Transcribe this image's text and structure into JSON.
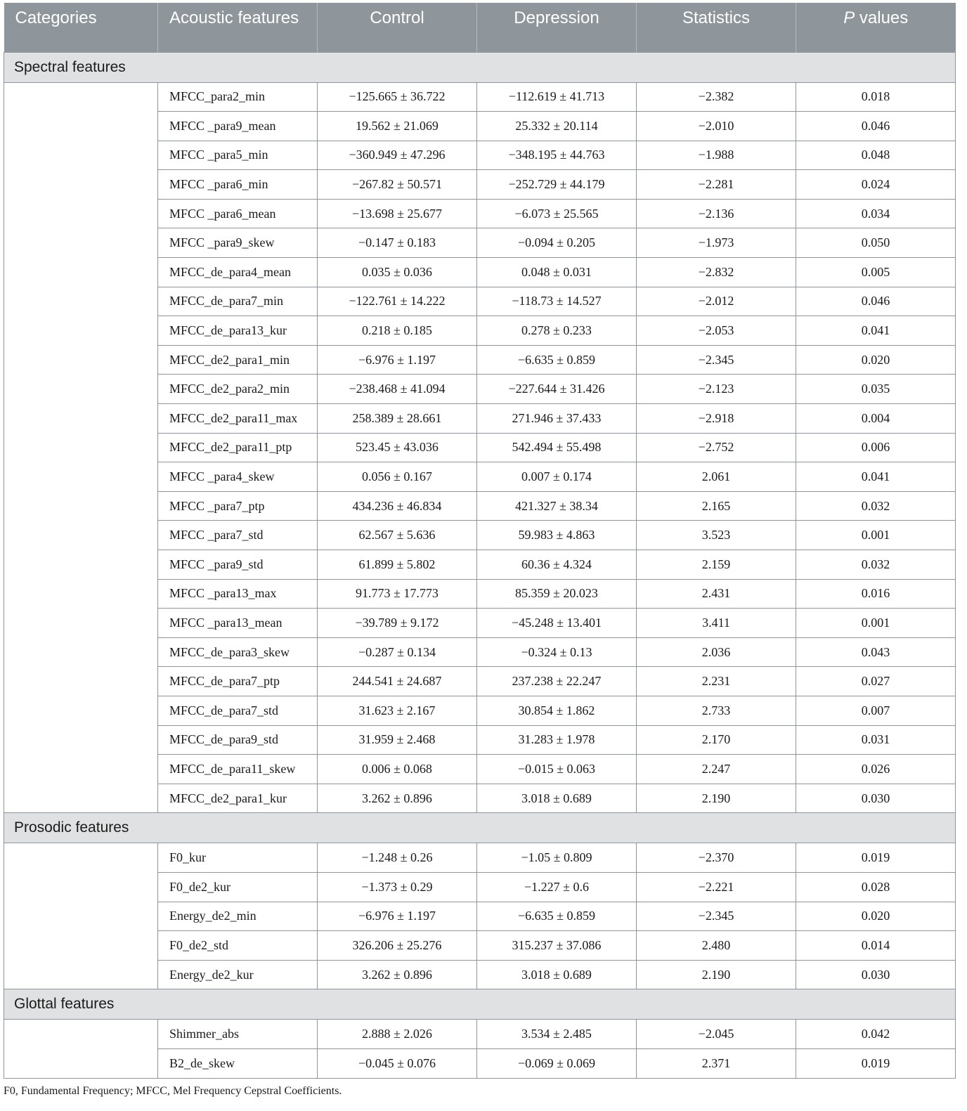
{
  "header": {
    "categories": "Categories",
    "acoustic_features": "Acoustic features",
    "control": "Control",
    "depression": "Depression",
    "statistics": "Statistics",
    "p_values_italic": "P",
    "p_values_rest": " values"
  },
  "sections": [
    {
      "name": "Spectral features",
      "rows": [
        {
          "feature": "MFCC_para2_min",
          "control": "−125.665 ± 36.722",
          "depression": "−112.619 ± 41.713",
          "statistics": "−2.382",
          "p": "0.018"
        },
        {
          "feature": "MFCC _para9_mean",
          "control": "19.562 ± 21.069",
          "depression": "25.332 ± 20.114",
          "statistics": "−2.010",
          "p": "0.046"
        },
        {
          "feature": "MFCC _para5_min",
          "control": "−360.949 ± 47.296",
          "depression": "−348.195 ± 44.763",
          "statistics": "−1.988",
          "p": "0.048"
        },
        {
          "feature": "MFCC _para6_min",
          "control": "−267.82 ± 50.571",
          "depression": "−252.729 ± 44.179",
          "statistics": "−2.281",
          "p": "0.024"
        },
        {
          "feature": "MFCC _para6_mean",
          "control": "−13.698 ± 25.677",
          "depression": "−6.073 ± 25.565",
          "statistics": "−2.136",
          "p": "0.034"
        },
        {
          "feature": "MFCC _para9_skew",
          "control": "−0.147 ± 0.183",
          "depression": "−0.094 ± 0.205",
          "statistics": "−1.973",
          "p": "0.050"
        },
        {
          "feature": "MFCC_de_para4_mean",
          "control": "0.035 ± 0.036",
          "depression": "0.048 ± 0.031",
          "statistics": "−2.832",
          "p": "0.005"
        },
        {
          "feature": "MFCC_de_para7_min",
          "control": "−122.761 ± 14.222",
          "depression": "−118.73 ± 14.527",
          "statistics": "−2.012",
          "p": "0.046"
        },
        {
          "feature": "MFCC_de_para13_kur",
          "control": "0.218 ± 0.185",
          "depression": "0.278 ± 0.233",
          "statistics": "−2.053",
          "p": "0.041"
        },
        {
          "feature": "MFCC_de2_para1_min",
          "control": "−6.976 ± 1.197",
          "depression": "−6.635 ± 0.859",
          "statistics": "−2.345",
          "p": "0.020"
        },
        {
          "feature": "MFCC_de2_para2_min",
          "control": "−238.468 ± 41.094",
          "depression": "−227.644 ± 31.426",
          "statistics": "−2.123",
          "p": "0.035"
        },
        {
          "feature": "MFCC_de2_para11_max",
          "control": "258.389 ± 28.661",
          "depression": "271.946 ± 37.433",
          "statistics": "−2.918",
          "p": "0.004"
        },
        {
          "feature": "MFCC_de2_para11_ptp",
          "control": "523.45 ± 43.036",
          "depression": "542.494 ± 55.498",
          "statistics": "−2.752",
          "p": "0.006"
        },
        {
          "feature": "MFCC _para4_skew",
          "control": "0.056 ± 0.167",
          "depression": "0.007 ± 0.174",
          "statistics": "2.061",
          "p": "0.041"
        },
        {
          "feature": "MFCC _para7_ptp",
          "control": "434.236 ± 46.834",
          "depression": "421.327 ± 38.34",
          "statistics": "2.165",
          "p": "0.032"
        },
        {
          "feature": "MFCC _para7_std",
          "control": "62.567 ± 5.636",
          "depression": "59.983 ± 4.863",
          "statistics": "3.523",
          "p": "0.001"
        },
        {
          "feature": "MFCC _para9_std",
          "control": "61.899 ± 5.802",
          "depression": "60.36 ± 4.324",
          "statistics": "2.159",
          "p": "0.032"
        },
        {
          "feature": "MFCC _para13_max",
          "control": "91.773 ± 17.773",
          "depression": "85.359 ± 20.023",
          "statistics": "2.431",
          "p": "0.016"
        },
        {
          "feature": "MFCC _para13_mean",
          "control": "−39.789 ± 9.172",
          "depression": "−45.248 ± 13.401",
          "statistics": "3.411",
          "p": "0.001"
        },
        {
          "feature": "MFCC_de_para3_skew",
          "control": "−0.287 ± 0.134",
          "depression": "−0.324 ± 0.13",
          "statistics": "2.036",
          "p": "0.043"
        },
        {
          "feature": "MFCC_de_para7_ptp",
          "control": "244.541 ± 24.687",
          "depression": "237.238 ± 22.247",
          "statistics": "2.231",
          "p": "0.027"
        },
        {
          "feature": "MFCC_de_para7_std",
          "control": "31.623 ± 2.167",
          "depression": "30.854 ± 1.862",
          "statistics": "2.733",
          "p": "0.007"
        },
        {
          "feature": "MFCC_de_para9_std",
          "control": "31.959 ± 2.468",
          "depression": "31.283 ± 1.978",
          "statistics": "2.170",
          "p": "0.031"
        },
        {
          "feature": "MFCC_de_para11_skew",
          "control": "0.006 ± 0.068",
          "depression": "−0.015 ± 0.063",
          "statistics": "2.247",
          "p": "0.026"
        },
        {
          "feature": "MFCC_de2_para1_kur",
          "control": "3.262 ± 0.896",
          "depression": "3.018 ± 0.689",
          "statistics": "2.190",
          "p": "0.030"
        }
      ]
    },
    {
      "name": "Prosodic features",
      "rows": [
        {
          "feature": "F0_kur",
          "control": "−1.248 ± 0.26",
          "depression": "−1.05 ± 0.809",
          "statistics": "−2.370",
          "p": "0.019"
        },
        {
          "feature": "F0_de2_kur",
          "control": "−1.373 ± 0.29",
          "depression": "−1.227 ± 0.6",
          "statistics": "−2.221",
          "p": "0.028"
        },
        {
          "feature": "Energy_de2_min",
          "control": "−6.976 ± 1.197",
          "depression": "−6.635 ± 0.859",
          "statistics": "−2.345",
          "p": "0.020"
        },
        {
          "feature": "F0_de2_std",
          "control": "326.206 ± 25.276",
          "depression": "315.237 ± 37.086",
          "statistics": "2.480",
          "p": "0.014"
        },
        {
          "feature": "Energy_de2_kur",
          "control": "3.262 ± 0.896",
          "depression": "3.018 ± 0.689",
          "statistics": "2.190",
          "p": "0.030"
        }
      ]
    },
    {
      "name": "Glottal features",
      "rows": [
        {
          "feature": "Shimmer_abs",
          "control": "2.888 ± 2.026",
          "depression": "3.534 ± 2.485",
          "statistics": "−2.045",
          "p": "0.042"
        },
        {
          "feature": "B2_de_skew",
          "control": "−0.045 ± 0.076",
          "depression": "−0.069 ± 0.069",
          "statistics": "2.371",
          "p": "0.019"
        }
      ]
    }
  ],
  "footnote": "F0, Fundamental Frequency; MFCC, Mel Frequency Cepstral Coefficients.",
  "colors": {
    "header_bg": "#8e969b",
    "category_bg": "#dfe1e2",
    "border": "#8e969b"
  }
}
